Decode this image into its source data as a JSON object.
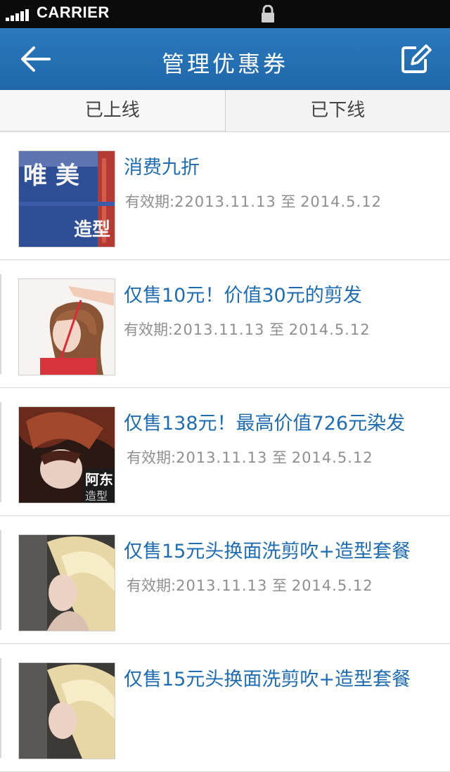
{
  "status_bar": {
    "carrier": "CARRIER"
  },
  "nav": {
    "title": "管理优惠券"
  },
  "tabs": [
    {
      "label": "已上线",
      "active": true
    },
    {
      "label": "已下线",
      "active": false
    }
  ],
  "coupons": [
    {
      "title": "消费九折",
      "validity_label": "有效期:",
      "start": "22013.11.13",
      "to": "至",
      "end": "2014.5.12",
      "thumb_text_top": "唯 美",
      "thumb_text_bottom": "造型"
    },
    {
      "title": "仅售10元！价值30元的剪发",
      "validity_label": "有效期:",
      "start": "2013.11.13",
      "to": "至",
      "end": "2014.5.12"
    },
    {
      "title": "仅售138元！最高价值726元染发",
      "validity_label": "有效期:",
      "start": "2013.11.13",
      "to": "至",
      "end": "2014.5.12",
      "thumb_text_top": "阿东",
      "thumb_text_bottom": "造型"
    },
    {
      "title": "仅售15元头换面洗剪吹+造型套餐",
      "validity_label": "有效期:",
      "start": "2013.11.13",
      "to": "至",
      "end": "2014.5.12"
    },
    {
      "title": "仅售15元头换面洗剪吹+造型套餐"
    }
  ],
  "colors": {
    "nav_bg": "#1f67aa",
    "title_blue": "#1f6cb0",
    "meta_gray": "#8f8f8f"
  },
  "icons": {
    "back": "arrow-left-icon",
    "edit": "edit-icon",
    "lock": "lock-icon",
    "signal": "signal-icon"
  }
}
